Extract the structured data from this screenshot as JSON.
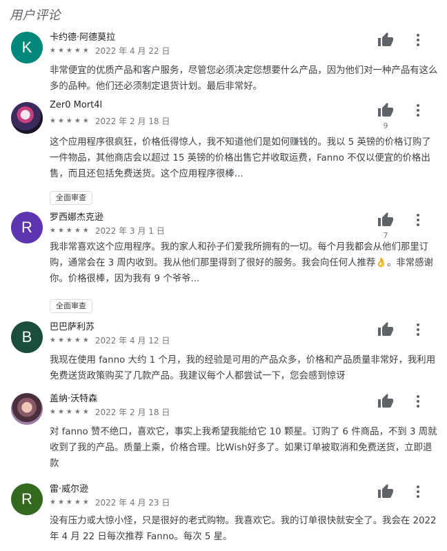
{
  "section_title": "用户评论",
  "stars_glyph": "★★★★★",
  "full_review_label": "全面审查",
  "reviews": [
    {
      "name": "卡约德·阿德莫拉",
      "date": "2022 年 4 月 22 日",
      "avatar_letter": "K",
      "avatar_color": "#00897b",
      "likes": "",
      "text": "非常便宜的优质产品和客户服务，尽管您必须决定您想要什么产品，因为他们对一种产品有这么多的品种。他们还必须制定退货计划。最后非常好。"
    },
    {
      "name": "Zer0 Mort4l",
      "date": "2022 年 2 月 18 日",
      "avatar_letter": "",
      "avatar_color": "#3a2a4a",
      "likes": "9",
      "text": "这个应用程序很疯狂，价格低得惊人，我不知道他们是如何赚钱的。我以 5 英镑的价格订购了一件物品，其他商店会以超过 15 英镑的价格出售它并收取运费，Fanno 不仅以便宜的价格出售，而且还包括免费送货。这个应用程序很棒..."
    },
    {
      "name": "罗西娜杰克逊",
      "date": "2022 年 3 月 1 日",
      "avatar_letter": "R",
      "avatar_color": "#5e35b1",
      "likes": "7",
      "text": "我非常喜欢这个应用程序。我的家人和孙子们爱我所拥有的一切。每个月我都会从他们那里订购，通常会在 3 周内收到。我从他们那里得到了很好的服务。我会向任何人推荐👌。非常感谢你。价格很棒，因为我有 9 个爷爷..."
    },
    {
      "name": "巴巴萨利苏",
      "date": "2022 年 4 月 12 日",
      "avatar_letter": "B",
      "avatar_color": "#1b4d3e",
      "likes": "",
      "text": "我现在使用 fanno 大约 1 个月，我的经验是可用的产品众多，价格和产品质量非常好，我利用免费送货政策购买了几款产品。我建议每个人都尝试一下，您会感到惊讶"
    },
    {
      "name": "盖纳·沃特森",
      "date": "2022 年 2 月 18 日",
      "avatar_letter": "",
      "avatar_color": "#6d4c5a",
      "likes": "",
      "text": "对 fanno 赞不绝口，喜欢它，事实上我希望我能给它 10 颗星。订购了 6 件商品，不到 3 周就收到了我的产品。质量上乘，价格合理。比Wish好多了。如果订单被取消和免费送货，立即退款"
    },
    {
      "name": "雷·威尔逊",
      "date": "2022 年 4 月 23 日",
      "avatar_letter": "R",
      "avatar_color": "#33691e",
      "likes": "",
      "text": "没有压力或大惊小怪，只是很好的老式购物。我喜欢它。我的订单很快就安全了。我会在 2022 年 4 月 22 日每次推荐 Fanno。每次 5 星。"
    }
  ]
}
